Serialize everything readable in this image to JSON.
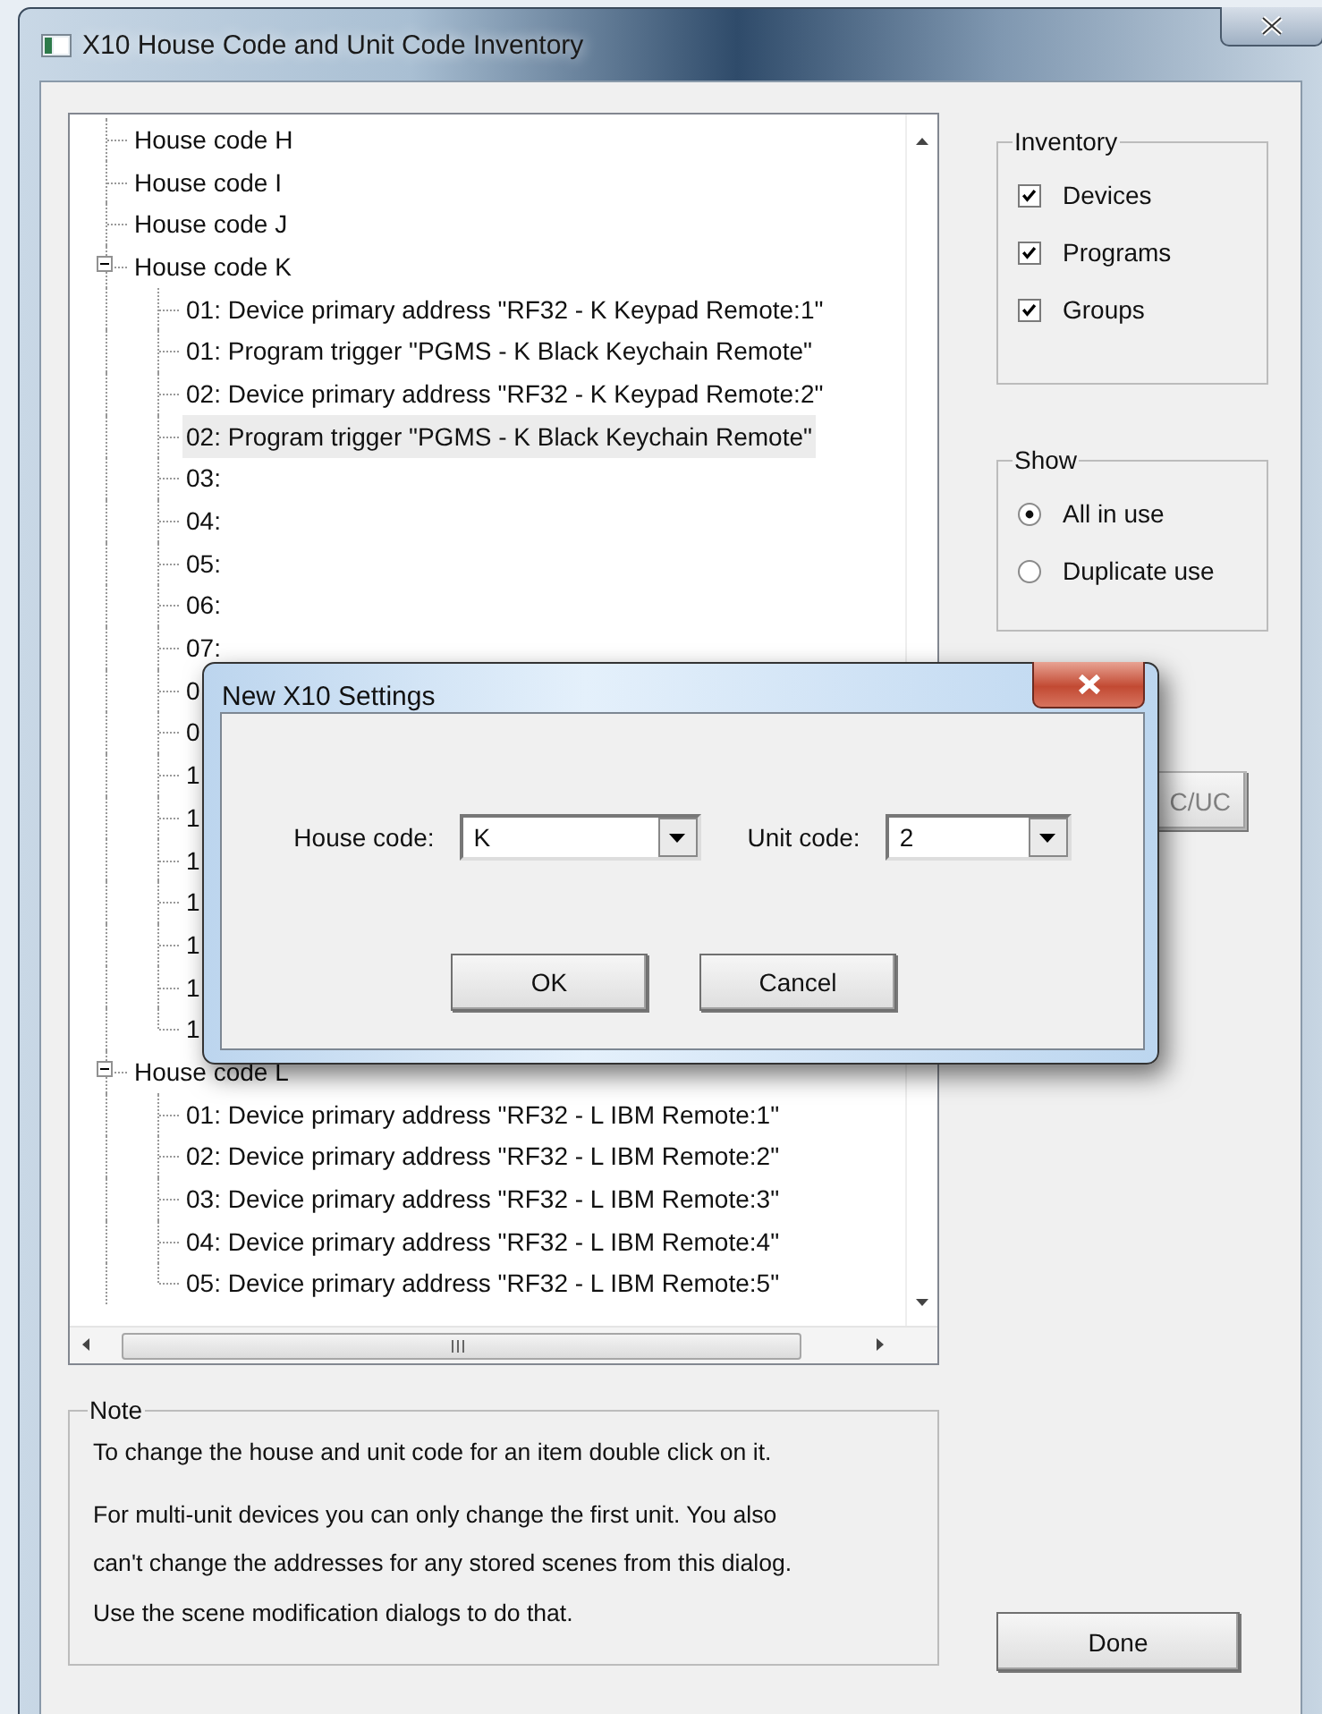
{
  "window": {
    "title": "X10 House Code and Unit Code Inventory"
  },
  "tree": {
    "items": [
      {
        "label": "House code H",
        "selected": false
      },
      {
        "label": "House code I",
        "selected": false
      },
      {
        "label": "House code J",
        "selected": false
      },
      {
        "label": "House code K",
        "selected": false,
        "expanded": true,
        "children": [
          {
            "label": "01: Device primary address \"RF32 - K Keypad Remote:1\"",
            "selected": false
          },
          {
            "label": "01: Program trigger \"PGMS - K Black Keychain Remote\"",
            "selected": false
          },
          {
            "label": "02: Device primary address \"RF32 - K Keypad Remote:2\"",
            "selected": false
          },
          {
            "label": "02: Program trigger \"PGMS - K Black Keychain Remote\"",
            "selected": true
          },
          {
            "label": "03:",
            "selected": false
          },
          {
            "label": "04:",
            "selected": false
          },
          {
            "label": "05:",
            "selected": false
          },
          {
            "label": "06:",
            "selected": false
          },
          {
            "label": "07:",
            "selected": false
          },
          {
            "label": "0",
            "selected": false
          },
          {
            "label": "0",
            "selected": false
          },
          {
            "label": "1",
            "selected": false
          },
          {
            "label": "1",
            "selected": false
          },
          {
            "label": "1",
            "selected": false
          },
          {
            "label": "1",
            "selected": false
          },
          {
            "label": "1",
            "selected": false
          },
          {
            "label": "1",
            "selected": false
          },
          {
            "label": "1",
            "selected": false
          }
        ]
      },
      {
        "label": "House code L",
        "selected": false,
        "expanded": true,
        "children": [
          {
            "label": "01: Device primary address \"RF32 - L IBM Remote:1\"",
            "selected": false
          },
          {
            "label": "02: Device primary address \"RF32 - L IBM Remote:2\"",
            "selected": false
          },
          {
            "label": "03: Device primary address \"RF32 - L IBM Remote:3\"",
            "selected": false
          },
          {
            "label": "04: Device primary address \"RF32 - L IBM Remote:4\"",
            "selected": false
          },
          {
            "label": "05: Device primary address \"RF32 - L IBM Remote:5\"",
            "selected": false
          }
        ]
      }
    ]
  },
  "inventory": {
    "title": "Inventory",
    "options": [
      {
        "label": "Devices",
        "checked": true
      },
      {
        "label": "Programs",
        "checked": true
      },
      {
        "label": "Groups",
        "checked": true
      }
    ]
  },
  "show": {
    "title": "Show",
    "options": [
      {
        "label": "All in use",
        "selected": true
      },
      {
        "label": "Duplicate use",
        "selected": false
      }
    ]
  },
  "change_button": {
    "label": "C/UC",
    "disabled": true
  },
  "note": {
    "title": "Note",
    "paragraphs": [
      "To change the house and unit code for an item double click on it.",
      "For multi-unit devices you can only change the first unit. You also can't change the addresses for any stored scenes from this dialog. Use the scene modification dialogs to do that."
    ]
  },
  "done_button": "Done",
  "dialog": {
    "title": "New X10 Settings",
    "fields": [
      {
        "label": "House code:",
        "value": "K"
      },
      {
        "label": "Unit code:",
        "value": "2"
      }
    ],
    "buttons": [
      "OK",
      "Cancel"
    ]
  }
}
